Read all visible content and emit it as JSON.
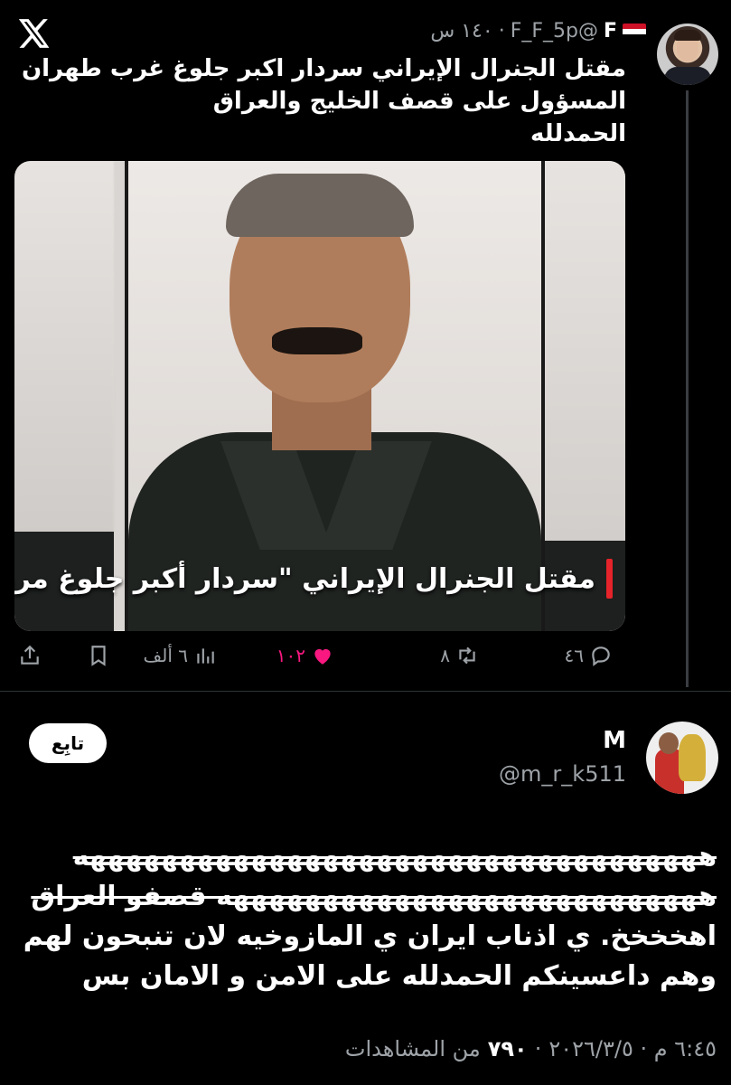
{
  "parent_tweet": {
    "display_name": "F",
    "handle": "@F_F_5p",
    "time_ago": "١٤٠ س",
    "text_lines": [
      "مقتل الجنرال الإيراني سردار اكبر جلوغ غرب طهران",
      "المسؤول على قصف الخليج والعراق",
      "الحمدلله"
    ],
    "media_caption": "مقتل الجنرال الإيراني \"سردار أكبر جلوغ مرد\"",
    "actions": {
      "replies": "٤٦",
      "retweets": "٨",
      "likes": "١٠٢",
      "views": "٦ ألف"
    }
  },
  "reply_tweet": {
    "display_name": "M",
    "handle": "@m_r_k511",
    "follow_label": "تابِع",
    "text_lines": [
      "هههههههههههههههههههههههههههههههههههه",
      "هههههههههههههههههههههههههههه قصفو العراق",
      "اهخخخخ. ي اذناب ايران ي المازوخيه لان تنبحون لهم",
      "وهم داعسينكم الحمدلله على الامن و الامان بس"
    ],
    "footer": {
      "timestamp": "٦:٤٥ م · ٢٠٢٦/٣/٥",
      "views_count": "٧٩٠",
      "views_label": "من المشاهدات"
    }
  },
  "icons": {
    "app_logo": "x-logo-icon",
    "flag": "iraq-flag-icon"
  },
  "colors": {
    "background": "#000000",
    "like": "#f91880",
    "muted": "#9ea3a8",
    "caption_bar": "#e5232a"
  }
}
